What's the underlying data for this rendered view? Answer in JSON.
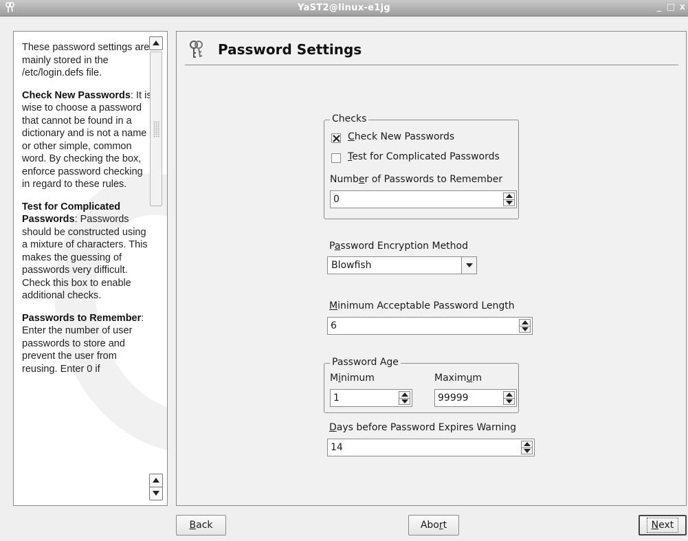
{
  "window": {
    "title": "YaST2@linux-e1jg",
    "minimize_glyph": "_",
    "maximize_glyph": "□",
    "close_glyph": "x"
  },
  "help": {
    "intro": "These password settings are mainly stored in the /etc/login.defs file.",
    "check_new_heading": "Check New Passwords",
    "check_new_text": ": It is wise to choose a password that cannot be found in a dictionary and is not a name or other simple, common word. By checking the box, enforce password checking in regard to these rules.",
    "complicated_heading": "Test for Complicated Passwords",
    "complicated_text": ": Passwords should be constructed using a mixture of characters. This makes the guessing of passwords very difficult. Check this box to enable additional checks.",
    "remember_heading": "Passwords to Remember",
    "remember_text": ": Enter the number of user passwords to store and prevent the user from reusing. Enter 0 if"
  },
  "page": {
    "title": "Password Settings",
    "icon": "keys-icon"
  },
  "checks": {
    "legend": "Checks",
    "check_new": {
      "prefix": "",
      "accel": "C",
      "rest": "heck New Passwords",
      "checked": true
    },
    "test_complicated": {
      "prefix": "",
      "accel": "T",
      "rest": "est for Complicated Passwords",
      "checked": false
    },
    "remember_label": {
      "prefix": "Numb",
      "accel": "e",
      "rest": "r of Passwords to Remember"
    },
    "remember_value": "0"
  },
  "encryption": {
    "label": {
      "prefix": "P",
      "accel": "a",
      "rest": "ssword Encryption Method"
    },
    "value": "Blowfish"
  },
  "min_length": {
    "label": {
      "prefix": "",
      "accel": "M",
      "rest": "inimum Acceptable Password Length"
    },
    "value": "6"
  },
  "age": {
    "legend": "Password Age",
    "min_label": {
      "prefix": "M",
      "accel": "i",
      "rest": "nimum"
    },
    "min_value": "1",
    "max_label": {
      "prefix": "Maxim",
      "accel": "u",
      "rest": "m"
    },
    "max_value": "99999"
  },
  "warning": {
    "label": {
      "prefix": "",
      "accel": "D",
      "rest": "ays before Password Expires Warning"
    },
    "value": "14"
  },
  "buttons": {
    "back": {
      "prefix": "",
      "accel": "B",
      "rest": "ack"
    },
    "abort": {
      "prefix": "Abo",
      "accel": "r",
      "rest": "t"
    },
    "next": {
      "prefix": "",
      "accel": "N",
      "rest": "ext"
    }
  }
}
